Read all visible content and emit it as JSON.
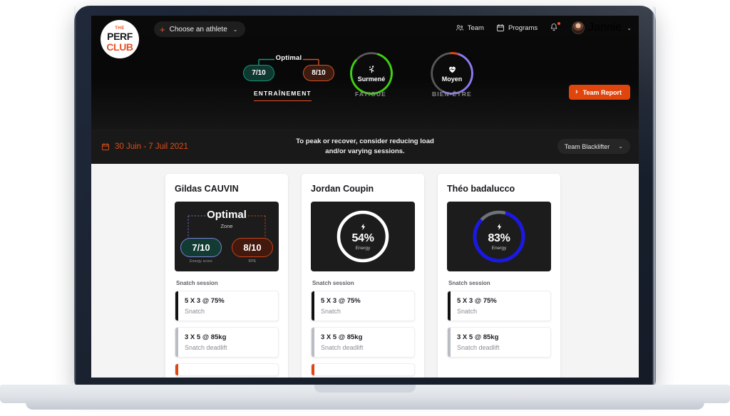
{
  "header": {
    "logo": {
      "line1": "THE",
      "line2": "PERF",
      "line3": "CLUB"
    },
    "athlete_picker": {
      "label": "Choose an athlete",
      "plus": "+",
      "chevron": "⌄"
    },
    "nav": [
      {
        "label": "Team",
        "icon": "people-icon"
      },
      {
        "label": "Programs",
        "icon": "calendar-icon"
      }
    ],
    "notifications_icon": "bell-icon",
    "user": {
      "name": "Jannie",
      "chevron": "⌄"
    }
  },
  "metrics": {
    "training": {
      "optimal_label": "Optimal",
      "energy_score": "7/10",
      "rpe": "8/10"
    },
    "fatigue": {
      "status": "Surmené",
      "icon": "runner-icon",
      "ring_color": "#3fd111",
      "percent": 80
    },
    "wellbeing": {
      "status": "Moyen",
      "icon": "heart-icon",
      "ring_color": "#8b7cf0",
      "percent": 55
    },
    "tabs": [
      {
        "label": "ENTRAÎNEMENT",
        "active": true
      },
      {
        "label": "FATIGUE",
        "active": false
      },
      {
        "label": "BIEN-ÊTRE",
        "active": false
      }
    ],
    "team_report_button": {
      "label": "Team Report",
      "chevron": "›",
      "color": "#e0450d"
    }
  },
  "date_bar": {
    "date_range": "30 Juin - 7 Juil 2021",
    "calendar_icon": "calendar-icon",
    "message_line1": "To peak or recover, consider reducing load",
    "message_line2": "and/or varying sessions.",
    "team_select": {
      "value": "Team Blacklifter",
      "chevron": "⌄"
    }
  },
  "cards": [
    {
      "name": "Gildas CAUVIN",
      "panel_type": "zone",
      "zone": {
        "title": "Optimal",
        "subtitle": "Zone",
        "left": {
          "value": "7/10",
          "caption": "Energy score"
        },
        "right": {
          "value": "8/10",
          "caption": "RPE"
        }
      },
      "session_title": "Snatch session",
      "exercises": [
        {
          "main": "5 X 3 @ 75%",
          "sub": "Snatch",
          "bar": "#111111"
        },
        {
          "main": "3 X 5 @ 85kg",
          "sub": "Snatch deadlift",
          "bar": "#b9bcc2"
        },
        {
          "main": "",
          "sub": "",
          "bar": "#e0450d"
        }
      ]
    },
    {
      "name": "Jordan Coupin",
      "panel_type": "energy",
      "energy": {
        "value": "54%",
        "caption": "Energy",
        "icon": "bolt-icon",
        "ring_color": "#ffffff",
        "percent": 100
      },
      "session_title": "Snatch session",
      "exercises": [
        {
          "main": "5 X 3 @ 75%",
          "sub": "Snatch",
          "bar": "#111111"
        },
        {
          "main": "3 X 5 @ 85kg",
          "sub": "Snatch deadlift",
          "bar": "#b9bcc2"
        },
        {
          "main": "",
          "sub": "",
          "bar": "#e0450d"
        }
      ]
    },
    {
      "name": "Théo badalucco",
      "panel_type": "energy",
      "energy": {
        "value": "83%",
        "caption": "Energy",
        "icon": "bolt-icon",
        "ring_color": "#1a18e8",
        "percent": 83
      },
      "session_title": "Snatch session",
      "exercises": [
        {
          "main": "5 X 3 @ 75%",
          "sub": "Snatch",
          "bar": "#111111"
        },
        {
          "main": "3 X 5 @ 85kg",
          "sub": "Snatch deadlift",
          "bar": "#b9bcc2"
        },
        {
          "main": "",
          "sub": "",
          "bar": "#e0450d"
        }
      ]
    }
  ]
}
